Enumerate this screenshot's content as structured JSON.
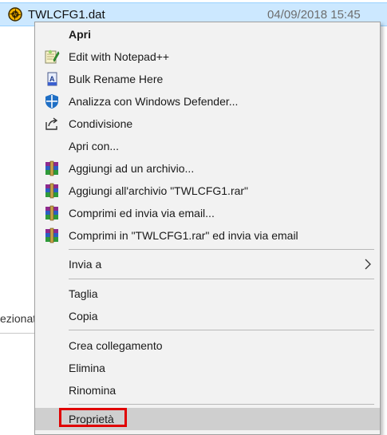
{
  "file": {
    "name": "TWLCFG1.dat",
    "date": "04/09/2018 15:45",
    "icon": "disc-file-icon"
  },
  "status": {
    "text": "ezionat"
  },
  "menu": {
    "items": [
      {
        "label": "Apri",
        "icon": "none"
      },
      {
        "label": "Edit with Notepad++",
        "icon": "notepad-plus-plus-icon"
      },
      {
        "label": "Bulk Rename Here",
        "icon": "bulk-rename-icon"
      },
      {
        "label": "Analizza con Windows Defender...",
        "icon": "windows-defender-shield-icon"
      },
      {
        "label": "Condivisione",
        "icon": "share-icon"
      },
      {
        "label": "Apri con...",
        "icon": "none"
      },
      {
        "label": "Aggiungi ad un archivio...",
        "icon": "winrar-icon"
      },
      {
        "label": "Aggiungi all'archivio \"TWLCFG1.rar\"",
        "icon": "winrar-icon"
      },
      {
        "label": "Comprimi ed invia via email...",
        "icon": "winrar-icon"
      },
      {
        "label": "Comprimi in \"TWLCFG1.rar\" ed invia via email",
        "icon": "winrar-icon"
      },
      {
        "label": "Invia a",
        "icon": "chevron-right-icon"
      },
      {
        "label": "Taglia",
        "icon": "none"
      },
      {
        "label": "Copia",
        "icon": "none"
      },
      {
        "label": "Crea collegamento",
        "icon": "none"
      },
      {
        "label": "Elimina",
        "icon": "none"
      },
      {
        "label": "Rinomina",
        "icon": "none"
      },
      {
        "label": "Proprietà",
        "icon": "none"
      }
    ]
  },
  "colors": {
    "menu_background": "#f2f2f2",
    "selection_row": "#cce8ff",
    "hover_item": "#cfcfcf",
    "annotation_red": "#e00000"
  }
}
